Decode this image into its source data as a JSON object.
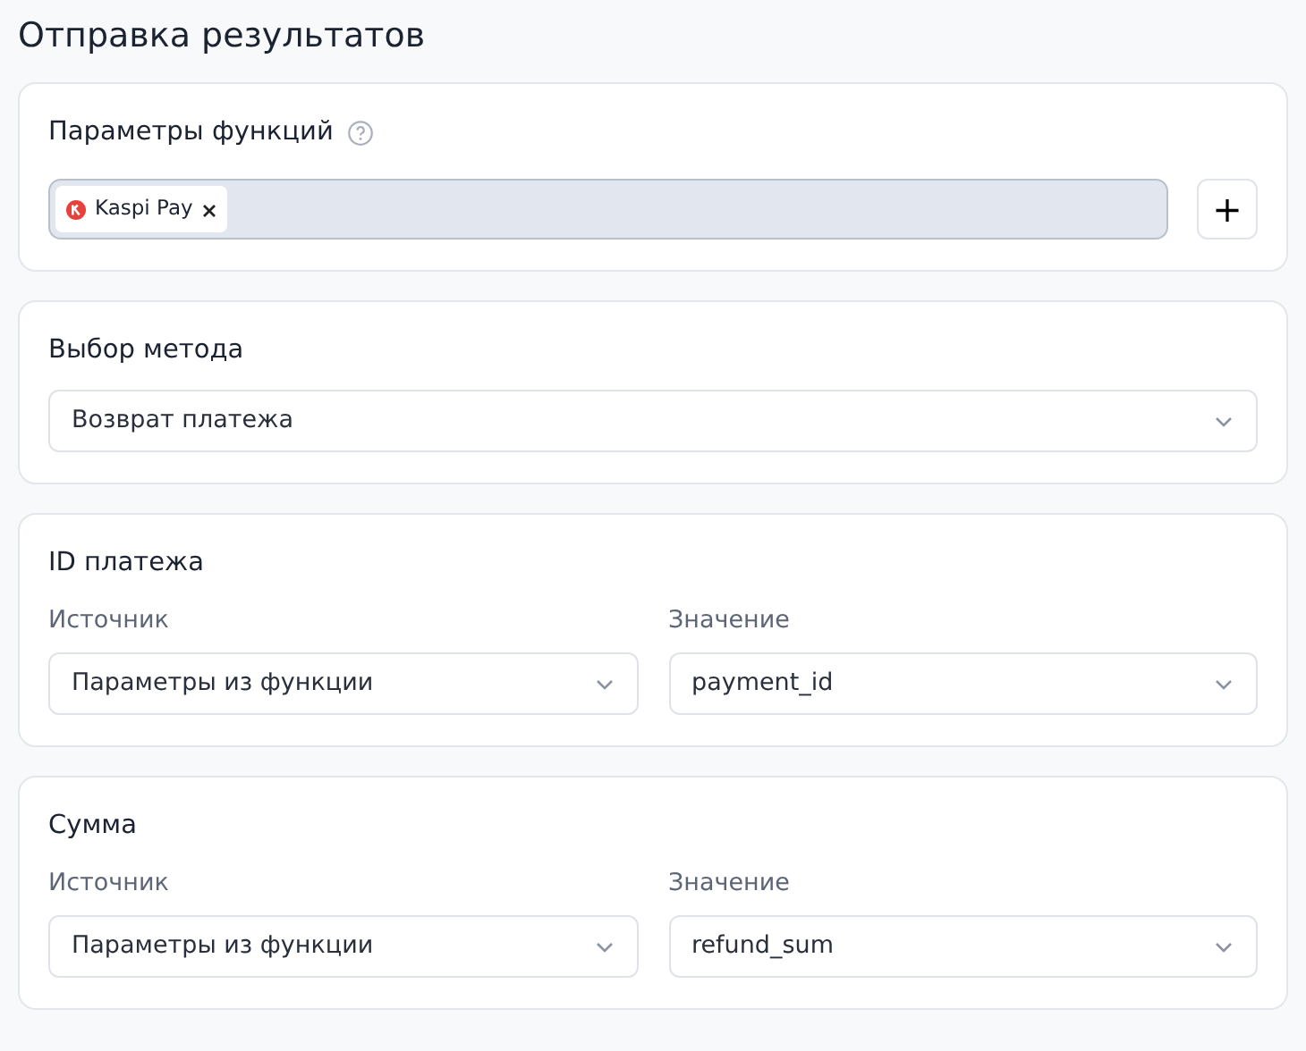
{
  "title": "Отправка результатов",
  "function_params": {
    "label": "Параметры функций",
    "tags": [
      {
        "label": "Kaspi Pay"
      }
    ],
    "add_button": "+"
  },
  "method": {
    "heading": "Выбор метода",
    "value": "Возврат платежа"
  },
  "sections": [
    {
      "heading": "ID платежа",
      "fields": [
        {
          "label": "Источник",
          "value": "Параметры из функции"
        },
        {
          "label": "Значение",
          "value": "payment_id"
        }
      ]
    },
    {
      "heading": "Сумма",
      "fields": [
        {
          "label": "Источник",
          "value": "Параметры из функции"
        },
        {
          "label": "Значение",
          "value": "refund_sum"
        }
      ]
    }
  ]
}
